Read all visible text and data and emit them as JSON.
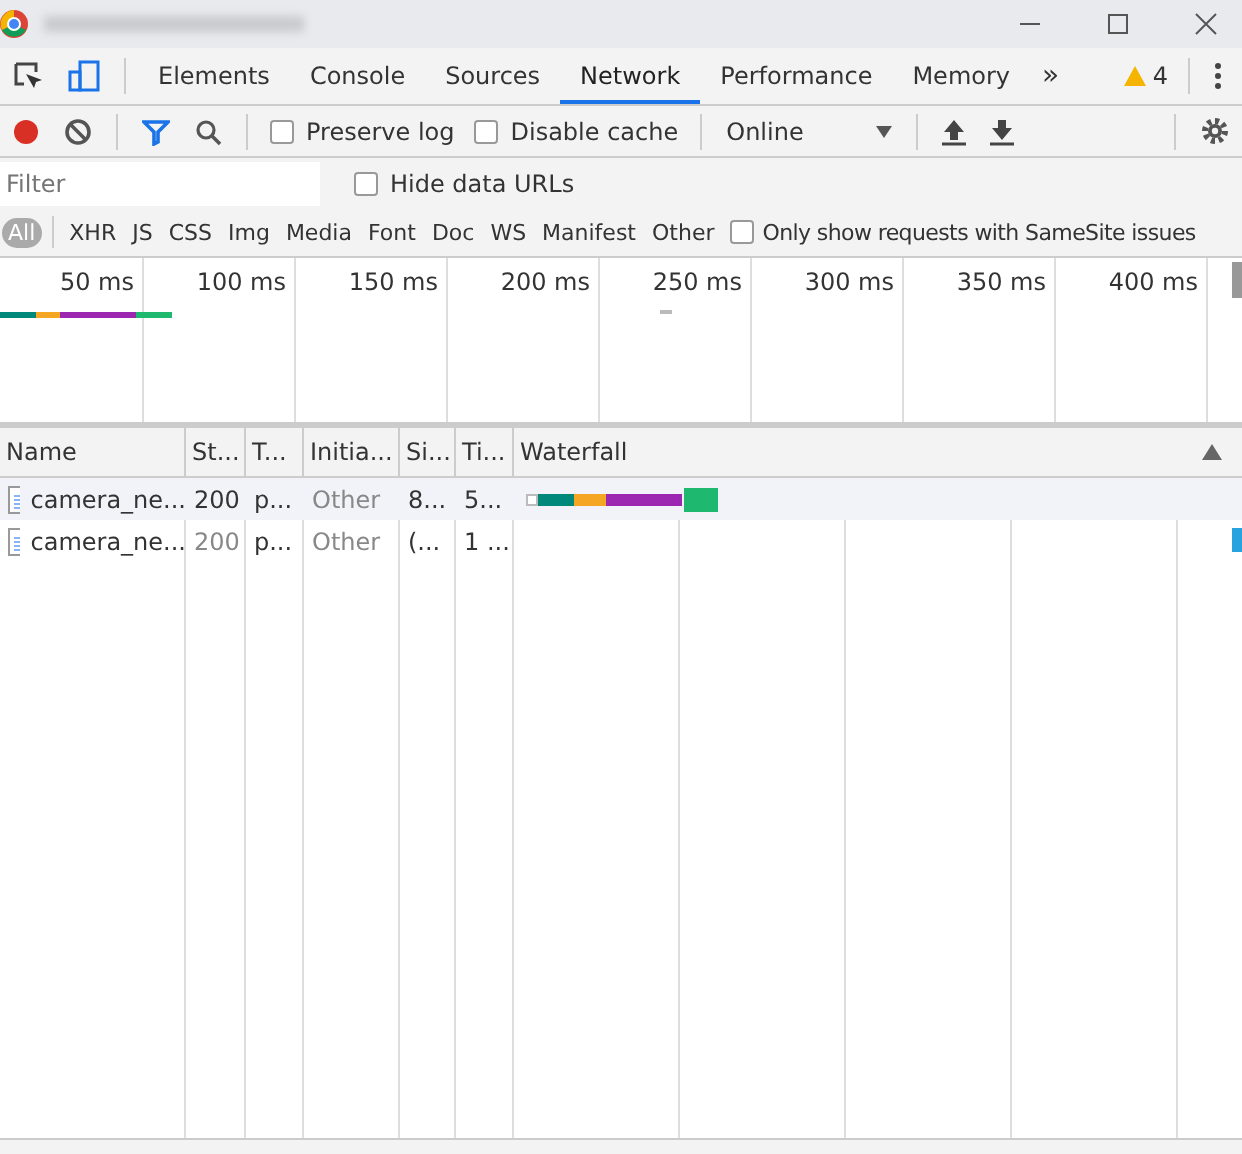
{
  "tabs": [
    {
      "label": "Elements",
      "selected": false
    },
    {
      "label": "Console",
      "selected": false
    },
    {
      "label": "Sources",
      "selected": false
    },
    {
      "label": "Network",
      "selected": true
    },
    {
      "label": "Performance",
      "selected": false
    },
    {
      "label": "Memory",
      "selected": false
    }
  ],
  "more_tabs": "»",
  "warnings": "4",
  "toolbar": {
    "recording": true,
    "preserve_log": {
      "label": "Preserve log",
      "checked": false
    },
    "disable_cache": {
      "label": "Disable cache",
      "checked": false
    },
    "throttling": "Online"
  },
  "filter": {
    "placeholder": "Filter",
    "hide_data_urls": {
      "label": "Hide data URLs",
      "checked": false
    }
  },
  "types": [
    {
      "label": "All",
      "selected": true
    },
    {
      "label": "XHR",
      "selected": false
    },
    {
      "label": "JS",
      "selected": false
    },
    {
      "label": "CSS",
      "selected": false
    },
    {
      "label": "Img",
      "selected": false
    },
    {
      "label": "Media",
      "selected": false
    },
    {
      "label": "Font",
      "selected": false
    },
    {
      "label": "Doc",
      "selected": false
    },
    {
      "label": "WS",
      "selected": false
    },
    {
      "label": "Manifest",
      "selected": false
    },
    {
      "label": "Other",
      "selected": false
    }
  ],
  "samesite": {
    "label": "Only show requests with SameSite issues",
    "checked": false
  },
  "overview_ticks": [
    "50 ms",
    "100 ms",
    "150 ms",
    "200 ms",
    "250 ms",
    "300 ms",
    "350 ms",
    "400 ms"
  ],
  "table": {
    "columns": [
      "Name",
      "St...",
      "T...",
      "Initia...",
      "Si...",
      "Ti...",
      "Waterfall"
    ],
    "rows": [
      {
        "cells": [
          "camera_ne...",
          "200",
          "p...",
          "Other",
          "8...",
          "5..."
        ],
        "status_dimmed": false
      },
      {
        "cells": [
          "camera_ne...",
          "200",
          "p...",
          "Other",
          "(...",
          "1 ..."
        ],
        "status_dimmed": true
      }
    ]
  }
}
